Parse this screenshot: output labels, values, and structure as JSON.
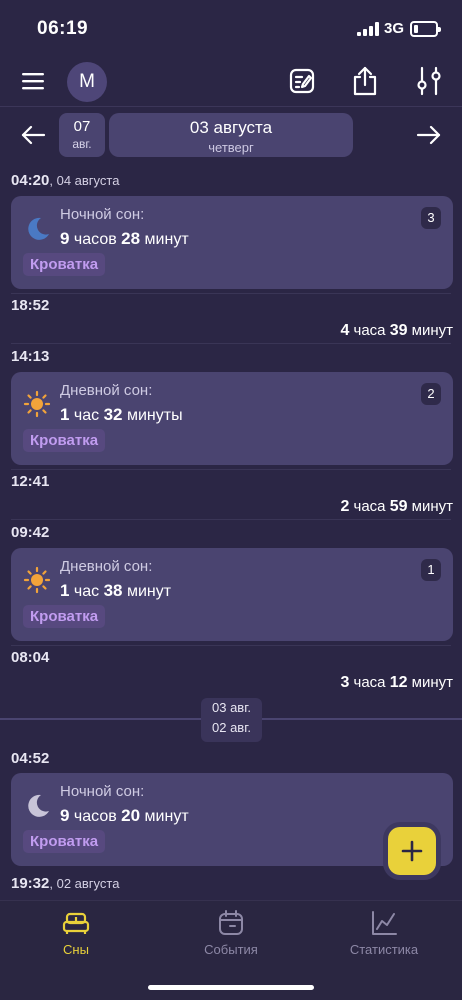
{
  "status_bar": {
    "time": "06:19",
    "network": "3G",
    "battery_icon": "battery-low-icon"
  },
  "toolbar": {
    "avatar_letter": "M",
    "menu_icon": "hamburger-icon",
    "edit_icon": "edit-note-icon",
    "share_icon": "share-icon",
    "filter_icon": "sliders-icon"
  },
  "date_nav": {
    "week_chip": {
      "day": "07",
      "month": "авг."
    },
    "day_chip": {
      "date": "03 августа",
      "weekday": "четверг"
    }
  },
  "timeline": [
    {
      "time": "04:20",
      "date_suffix": ", 04 августа"
    },
    {
      "card": {
        "icon": "moon-blue-icon",
        "title": "Ночной сон:",
        "h": "9",
        "h_unit": " часов ",
        "m": "28",
        "m_unit": " минут",
        "tag": "Кроватка",
        "badge": "3"
      }
    },
    {
      "time": "18:52"
    },
    {
      "gap": {
        "h": "4",
        "h_unit": " часа ",
        "m": "39",
        "m_unit": " минут"
      }
    },
    {
      "time": "14:13"
    },
    {
      "card": {
        "icon": "sun-icon",
        "title": "Дневной сон:",
        "h": "1",
        "h_unit": " час ",
        "m": "32",
        "m_unit": " минуты",
        "tag": "Кроватка",
        "badge": "2"
      }
    },
    {
      "time": "12:41"
    },
    {
      "gap": {
        "h": "2",
        "h_unit": " часа ",
        "m": "59",
        "m_unit": " минут"
      }
    },
    {
      "time": "09:42"
    },
    {
      "card": {
        "icon": "sun-icon",
        "title": "Дневной сон:",
        "h": "1",
        "h_unit": " час ",
        "m": "38",
        "m_unit": " минут",
        "tag": "Кроватка",
        "badge": "1"
      }
    },
    {
      "time": "08:04"
    },
    {
      "gap": {
        "h": "3",
        "h_unit": " часа ",
        "m": "12",
        "m_unit": " минут"
      }
    },
    {
      "day_separator": {
        "upper": "03 авг.",
        "lower": "02 авг."
      }
    },
    {
      "time": "04:52"
    },
    {
      "card": {
        "icon": "moon-grey-icon",
        "title": "Ночной сон:",
        "h": "9",
        "h_unit": " часов ",
        "m": "20",
        "m_unit": " минут",
        "tag": "Кроватка"
      }
    },
    {
      "time": "19:32",
      "date_suffix": ", 02 августа"
    }
  ],
  "fab": {
    "icon": "plus-icon"
  },
  "tabs": [
    {
      "label": "Сны",
      "icon": "bed-icon",
      "active": true
    },
    {
      "label": "События",
      "icon": "calendar-icon",
      "active": false
    },
    {
      "label": "Статистика",
      "icon": "chart-icon",
      "active": false
    }
  ],
  "colors": {
    "background": "#2b2645",
    "card": "#4a4470",
    "accent": "#e9d13a",
    "tag_text": "#c19cf0"
  }
}
